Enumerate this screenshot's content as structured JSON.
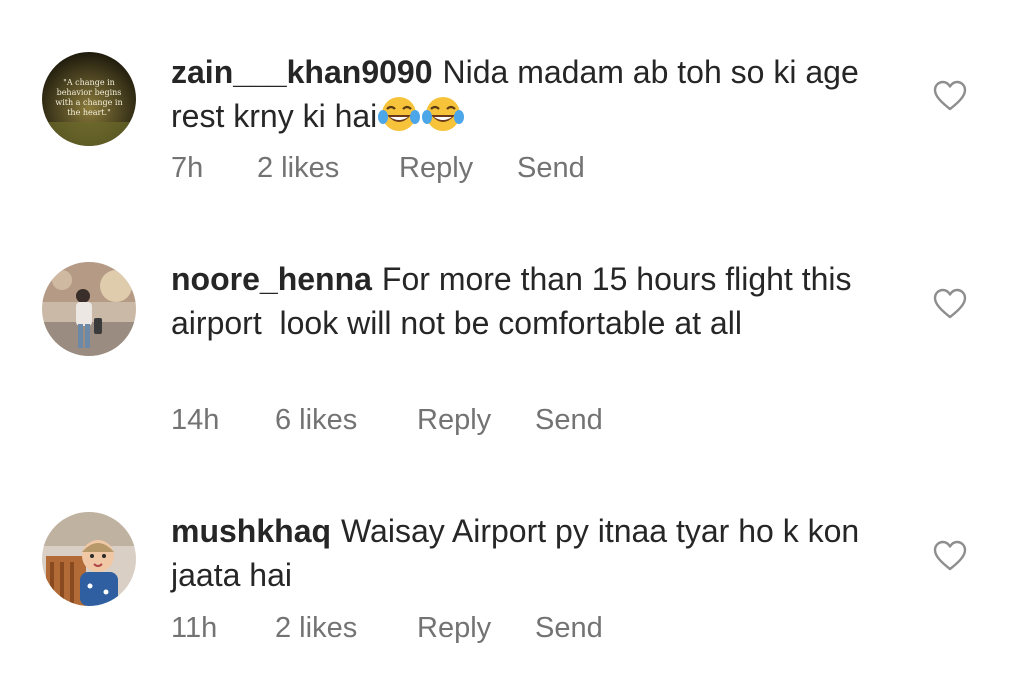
{
  "comments": [
    {
      "username": "zain___khan9090",
      "text": "Nida madam ab toh so ki age rest krny ki hai",
      "emoji": [
        "face-with-tears-of-joy-icon",
        "face-with-tears-of-joy-icon"
      ],
      "time": "7h",
      "likes": "2 likes",
      "reply": "Reply",
      "send": "Send",
      "avatar_quote": [
        "\"A change in",
        "behavior begins",
        "with a change in",
        "the heart.\""
      ]
    },
    {
      "username": "noore_henna",
      "text": "For more than 15 hours flight this airport  look will not be comfortable at all",
      "time": "14h",
      "likes": "6 likes",
      "reply": "Reply",
      "send": "Send"
    },
    {
      "username": "mushkhaq",
      "text": "Waisay Airport py itnaa tyar ho k kon jaata hai",
      "time": "11h",
      "likes": "2 likes",
      "reply": "Reply",
      "send": "Send"
    }
  ],
  "colors": {
    "text": "#262626",
    "meta": "#737373",
    "heart_outline": "#8e8e8e"
  }
}
